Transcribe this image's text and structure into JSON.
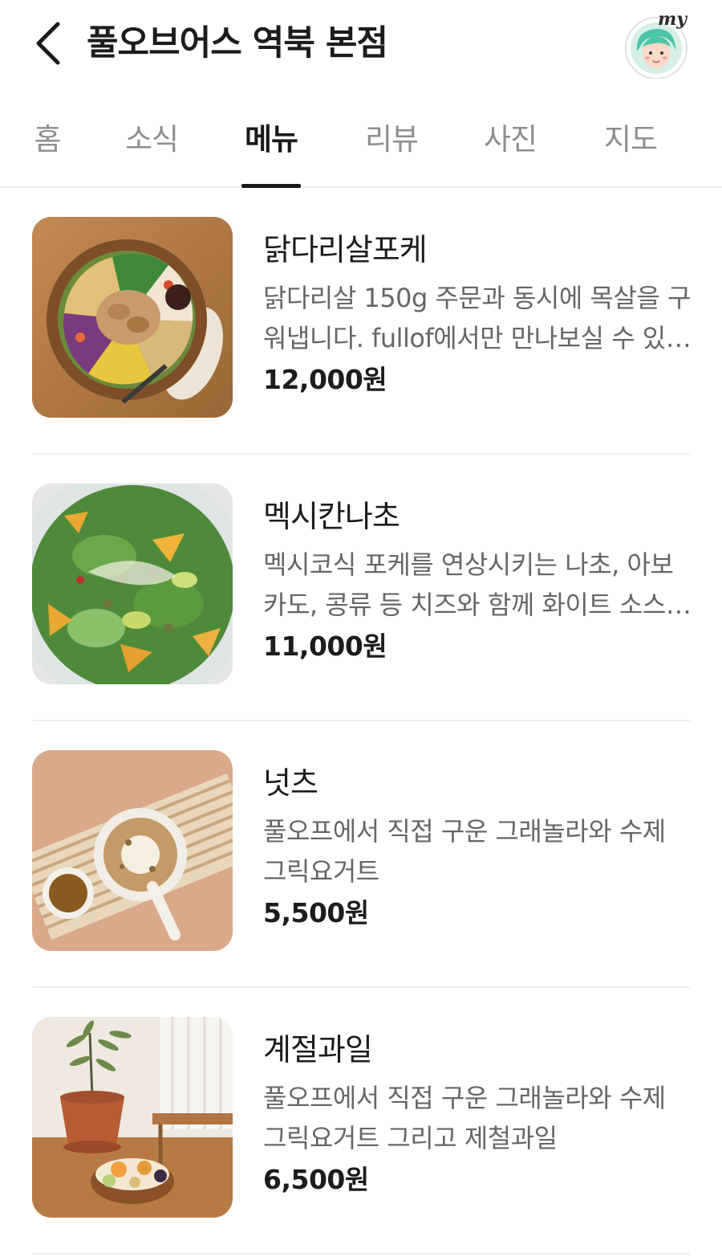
{
  "header": {
    "title": "풀오브어스 역북 본점",
    "my_label": "my"
  },
  "tabs": [
    {
      "label": "홈",
      "active": false
    },
    {
      "label": "소식",
      "active": false
    },
    {
      "label": "메뉴",
      "active": true
    },
    {
      "label": "리뷰",
      "active": false
    },
    {
      "label": "사진",
      "active": false
    },
    {
      "label": "지도",
      "active": false
    }
  ],
  "menu": [
    {
      "name": "닭다리살포케",
      "description": "닭다리살 150g 주문과 동시에 목살을 구워냅니다. fullof에서만 만나보실 수 있습니다",
      "price": "12,000원",
      "image": "chicken-poke-bowl"
    },
    {
      "name": "멕시칸나초",
      "description": "멕시코식 포케를 연상시키는 나초, 아보카도, 콩류 등 치즈와 함께 화이트 소스로 즐기는 메뉴",
      "price": "11,000원",
      "image": "mexican-nacho-salad"
    },
    {
      "name": "넛츠",
      "description": "풀오프에서 직접 구운 그래놀라와 수제 그릭요거트",
      "price": "5,500원",
      "image": "granola-yogurt-bowl"
    },
    {
      "name": "계절과일",
      "description": "풀오프에서 직접 구운 그래놀라와 수제 그릭요거트 그리고 제철과일",
      "price": "6,500원",
      "image": "seasonal-fruit-bowl"
    }
  ],
  "colors": {
    "accent": "#1a1a1a",
    "inactive_tab": "#8e8e8e",
    "description": "#666666",
    "divider": "#efefef"
  }
}
